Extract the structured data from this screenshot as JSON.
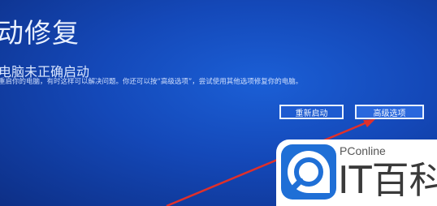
{
  "recovery": {
    "title": "动修复",
    "subtitle": "电脑未正确启动",
    "description": "重启你的电脑，有时这样可以解决问题。你还可以按“高级选项”，尝试使用其他选项修复你的电脑。",
    "restart_button": "重新启动",
    "advanced_button": "高级选项"
  },
  "watermark": {
    "small_text": "PConline",
    "big_text": "IT百科"
  },
  "colors": {
    "background": "#1448b8",
    "arrow": "#e0302a",
    "logo_blue": "#1f6fd6"
  }
}
